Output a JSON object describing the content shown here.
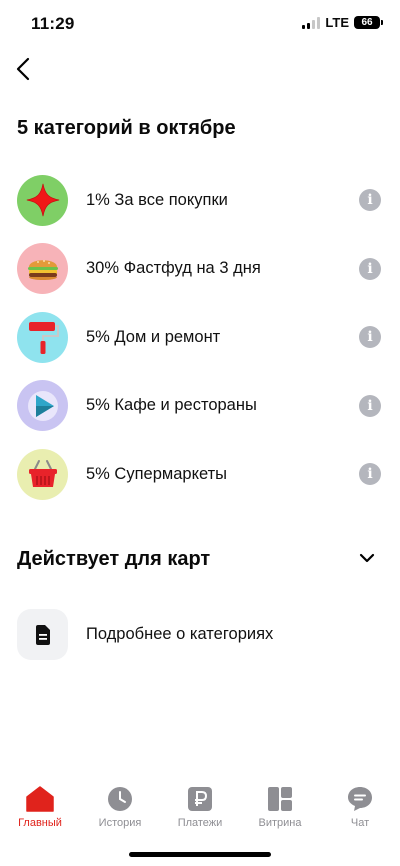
{
  "status_bar": {
    "time": "11:29",
    "network": "LTE",
    "battery": "66"
  },
  "header": {
    "back_icon": "chevron-left-icon"
  },
  "title": "5 категорий в октябре",
  "categories": [
    {
      "label": "1% За все покупки",
      "icon": "star-icon",
      "icon_bg": "#7fcf66"
    },
    {
      "label": "30% Фастфуд на 3 дня",
      "icon": "burger-icon",
      "icon_bg": "#f7b3b8"
    },
    {
      "label": "5% Дом и ремонт",
      "icon": "paint-roller-icon",
      "icon_bg": "#8fe3ee"
    },
    {
      "label": "5% Кафе и рестораны",
      "icon": "play-icon",
      "icon_bg": "#c9c4f2"
    },
    {
      "label": "5% Супермаркеты",
      "icon": "basket-icon",
      "icon_bg": "#e9eeb0"
    }
  ],
  "section": {
    "title": "Действует для карт",
    "chevron_icon": "chevron-down-icon"
  },
  "details": {
    "label": "Подробнее о категориях",
    "icon": "document-icon"
  },
  "tabs": [
    {
      "label": "Главный",
      "icon": "home-icon",
      "active": true
    },
    {
      "label": "История",
      "icon": "clock-icon",
      "active": false
    },
    {
      "label": "Платежи",
      "icon": "ruble-icon",
      "active": false
    },
    {
      "label": "Витрина",
      "icon": "showcase-icon",
      "active": false
    },
    {
      "label": "Чат",
      "icon": "chat-icon",
      "active": false
    }
  ],
  "colors": {
    "accent": "#e0231c",
    "inactive": "#8e8e93",
    "info": "#b4b6bd"
  }
}
